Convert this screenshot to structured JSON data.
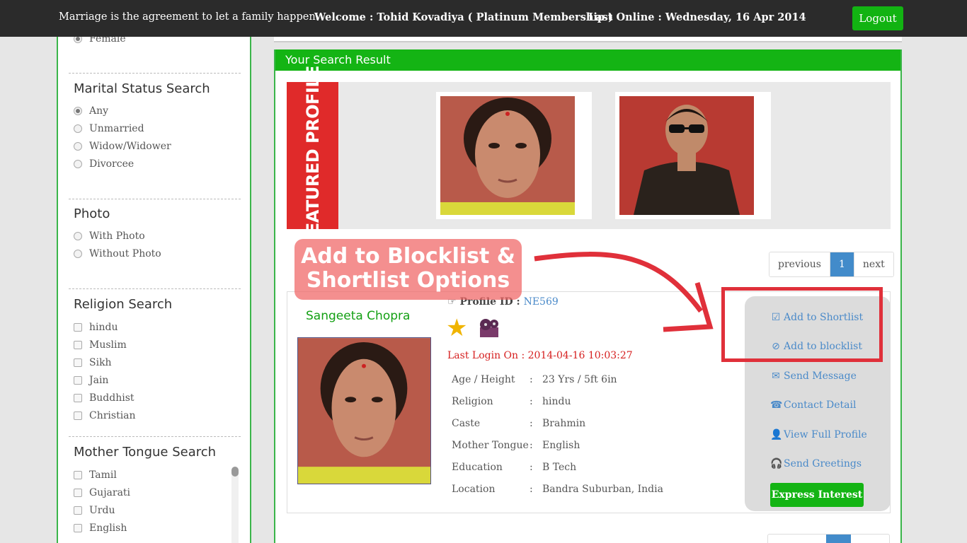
{
  "topbar": {
    "tagline": "Marriage is the agreement to let a family happen.",
    "welcome": "Welcome : Tohid Kovadiya ( Platinum Membership )",
    "last_online": "Last Online : Wednesday, 16 Apr 2014",
    "logout": "Logout"
  },
  "sidebar": {
    "gender_partial": "Female",
    "marital": {
      "title": "Marital Status Search",
      "options": [
        "Any",
        "Unmarried",
        "Widow/Widower",
        "Divorcee"
      ],
      "selected": "Any"
    },
    "photo": {
      "title": "Photo",
      "options": [
        "With Photo",
        "Without Photo"
      ]
    },
    "religion": {
      "title": "Religion Search",
      "options": [
        "hindu",
        "Muslim",
        "Sikh",
        "Jain",
        "Buddhist",
        "Christian"
      ]
    },
    "mother_tongue": {
      "title": "Mother Tongue Search",
      "options": [
        "Tamil",
        "Gujarati",
        "Urdu",
        "English"
      ]
    }
  },
  "main": {
    "panel_title": "Your Search Result",
    "featured_label": "FEATURED PROFILE",
    "pager": {
      "prev": "previous",
      "page": "1",
      "next": "next"
    },
    "profile": {
      "name": "Sangeeta Chopra",
      "id_label": "Profile ID :",
      "id_value": "NE569",
      "last_login": "Last Login On  :  2014-04-16 10:03:27",
      "details": [
        {
          "k": "Age / Height",
          "v": "23 Yrs / 5ft 6in"
        },
        {
          "k": "Religion",
          "v": "hindu"
        },
        {
          "k": "Caste",
          "v": "Brahmin"
        },
        {
          "k": "Mother Tongue",
          "v": "English"
        },
        {
          "k": "Education",
          "v": "B Tech"
        },
        {
          "k": "Location",
          "v": "Bandra Suburban, India"
        }
      ],
      "actions": [
        {
          "label": "Add to Shortlist",
          "icon": "check-square-icon"
        },
        {
          "label": "Add to blocklist",
          "icon": "ban-icon"
        },
        {
          "label": "Send Message",
          "icon": "envelope-icon"
        },
        {
          "label": "Contact Detail",
          "icon": "phone-icon"
        },
        {
          "label": "View Full Profile",
          "icon": "user-icon"
        },
        {
          "label": "Send Greetings",
          "icon": "headphones-icon"
        }
      ],
      "express_interest": "Express Interest"
    }
  },
  "annotation": {
    "callout_line1": "Add to Blocklist &",
    "callout_line2": "Shortlist Options"
  },
  "colors": {
    "accent_green": "#14b414",
    "link_blue": "#4a8ac9",
    "annotation_red": "#e0303a",
    "topbar": "#2b2b2b"
  }
}
